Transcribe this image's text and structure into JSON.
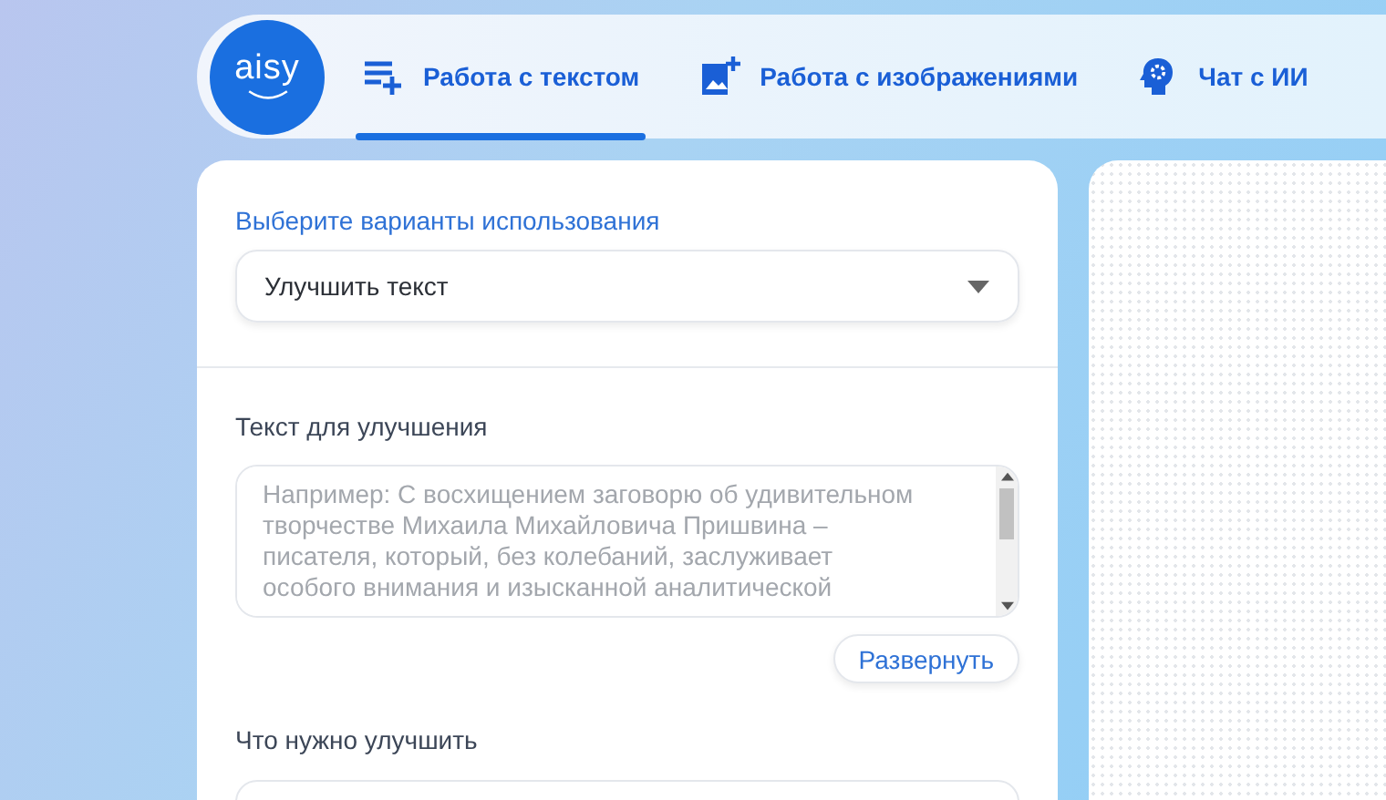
{
  "logo": {
    "text": "aisy"
  },
  "tabs": [
    {
      "label": "Работа с текстом",
      "kind": "text",
      "selected": true
    },
    {
      "label": "Работа с изображениями",
      "kind": "image",
      "selected": false
    },
    {
      "label": "Чат с ИИ",
      "kind": "head",
      "selected": false
    }
  ],
  "form": {
    "usage_label": "Выберите варианты использования",
    "usage_value": "Улучшить текст",
    "text_label": "Текст для улучшения",
    "text_placeholder": "Например: С восхищением заговорю об удивительном творчестве Михаила Михайловича Пришвина – писателя, который, без колебаний, заслуживает особого внимания и изысканной аналитической",
    "expand_button": "Развернуть",
    "improve_label": "Что нужно улучшить"
  }
}
